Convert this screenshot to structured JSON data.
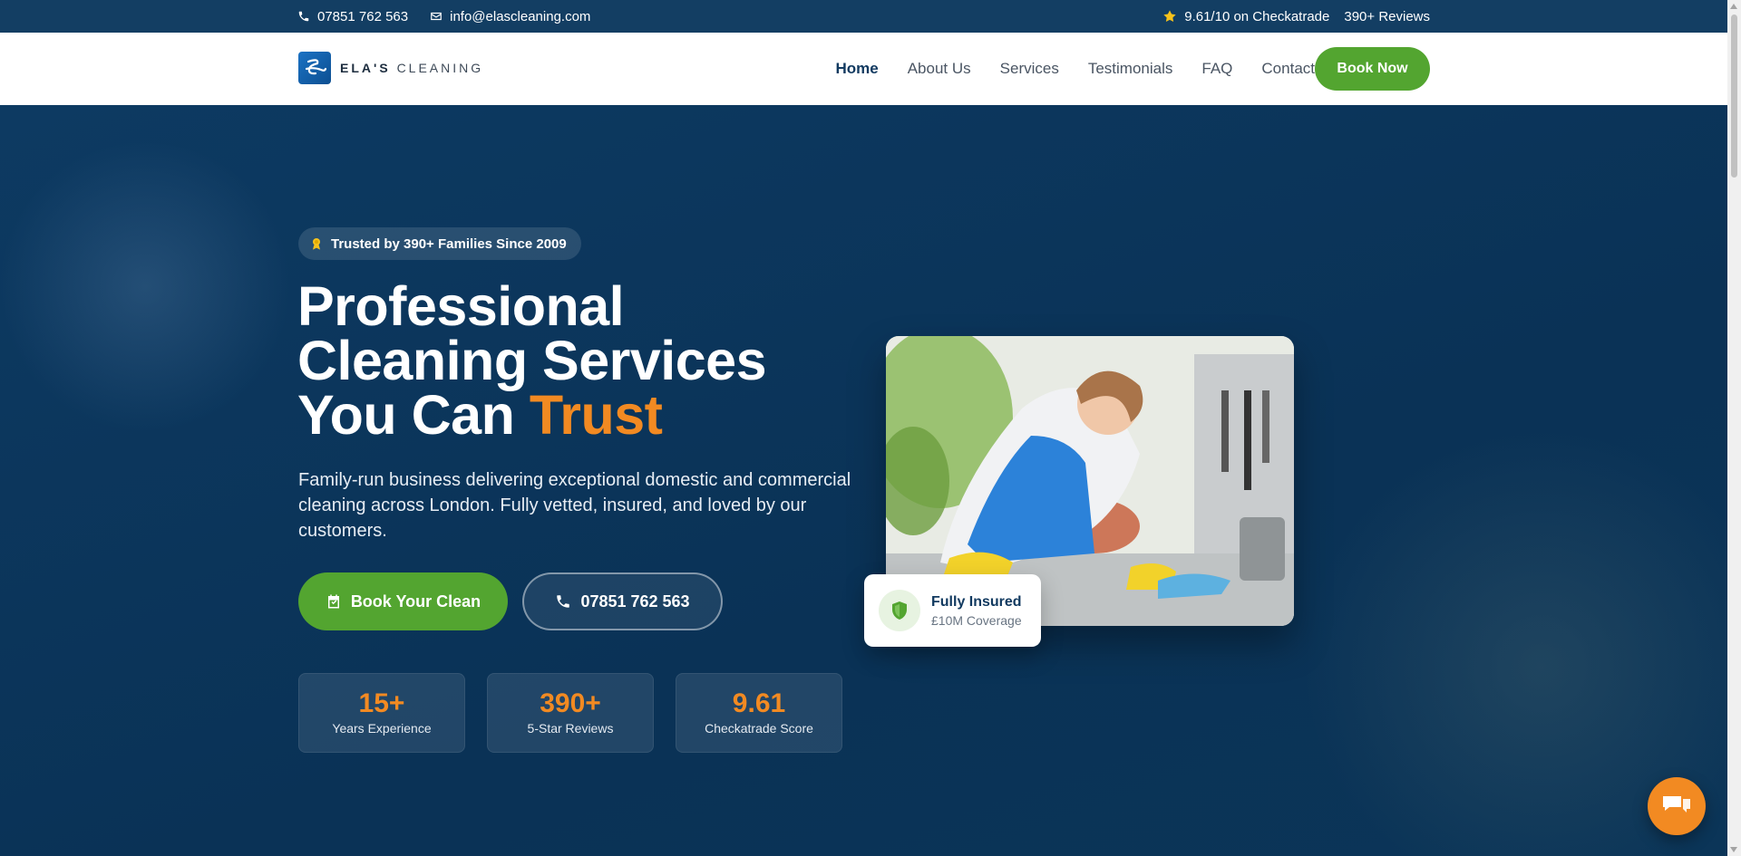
{
  "topbar": {
    "phone": "07851 762 563",
    "email": "info@elascleaning.com",
    "rating": "9.61/10 on Checkatrade",
    "reviews": "390+ Reviews"
  },
  "brand": {
    "name_bold": "ELA'S",
    "name_rest": "CLEANING"
  },
  "nav": {
    "items": [
      "Home",
      "About Us",
      "Services",
      "Testimonials",
      "FAQ",
      "Contact"
    ],
    "active": "Home",
    "cta": "Book Now"
  },
  "hero": {
    "badge": "Trusted by 390+ Families Since 2009",
    "title_line1": "Professional",
    "title_line2": "Cleaning Services",
    "title_line3_start": "You Can ",
    "title_line3_accent": "Trust",
    "subtitle": "Family-run business delivering exceptional domestic and commercial cleaning across London. Fully vetted, insured, and loved by our customers.",
    "primary_button": "Book Your Clean",
    "phone_button": "07851 762 563"
  },
  "stats": [
    {
      "value": "15+",
      "label": "Years Experience"
    },
    {
      "value": "390+",
      "label": "5-Star Reviews"
    },
    {
      "value": "9.61",
      "label": "Checkatrade Score"
    }
  ],
  "insured_card": {
    "title": "Fully Insured",
    "subtitle": "£10M Coverage"
  },
  "colors": {
    "navy": "#0b3558",
    "green": "#53a530",
    "orange": "#f28a22"
  },
  "icons": {
    "phone": "phone-icon",
    "email": "envelope-icon",
    "star": "star-icon",
    "award": "award-icon",
    "calendar": "calendar-icon",
    "shield": "shield-icon",
    "chat": "chat-icon"
  }
}
